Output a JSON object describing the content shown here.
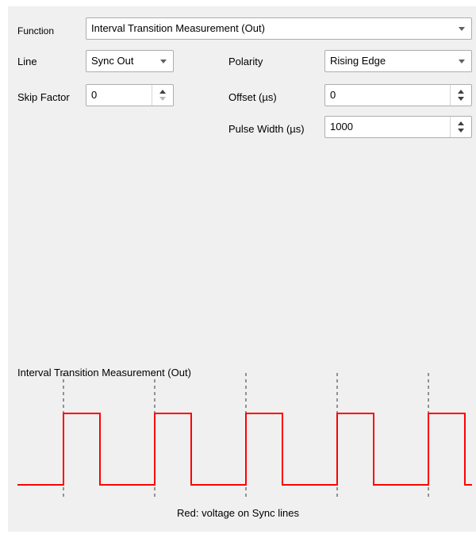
{
  "form": {
    "function": {
      "label": "Function",
      "value": "Interval Transition Measurement (Out)"
    },
    "line": {
      "label": "Line",
      "value": "Sync Out"
    },
    "polarity": {
      "label": "Polarity",
      "value": "Rising Edge"
    },
    "skip_factor": {
      "label": "Skip Factor",
      "value": "0"
    },
    "offset": {
      "label": "Offset (µs)",
      "value": "0"
    },
    "pulse_width": {
      "label": "Pulse Width (µs)",
      "value": "1000"
    }
  },
  "scope": {
    "title": "Interval Transition Measurement (Out)",
    "caption": "Red: voltage on Sync lines",
    "waveform_color": "#ff0000",
    "marker_color": "#606060",
    "waveform": {
      "signal": "square",
      "polarity": "rising-edge",
      "pulses_visible": 5,
      "duty_fraction": 0.4
    }
  }
}
